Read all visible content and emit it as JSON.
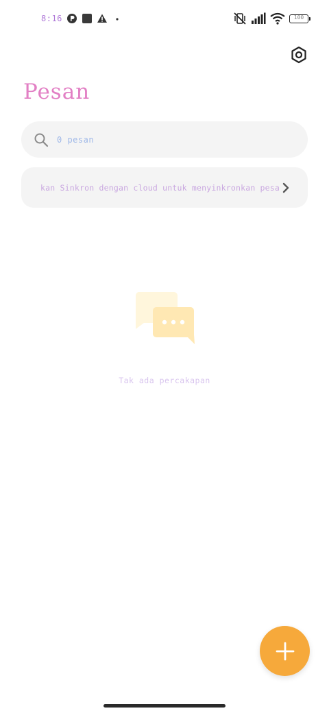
{
  "status_bar": {
    "time": "8:16",
    "battery": "100"
  },
  "header": {
    "title": "Pesan"
  },
  "search": {
    "placeholder": "0 pesan"
  },
  "sync_banner": {
    "text": "kan Sinkron dengan cloud untuk menyinkronkan pesan"
  },
  "empty_state": {
    "text": "Tak ada percakapan"
  },
  "colors": {
    "fab": "#f6a93b",
    "empty_icon_back": "#fff6dc",
    "empty_icon_front": "#ffe8b3",
    "title": "#e27fc4"
  },
  "icons": {
    "settings": "hexagon-gear-icon",
    "search": "search-icon",
    "chevron": "chevron-right-icon",
    "empty": "chat-bubbles-icon",
    "fab": "plus-icon"
  }
}
